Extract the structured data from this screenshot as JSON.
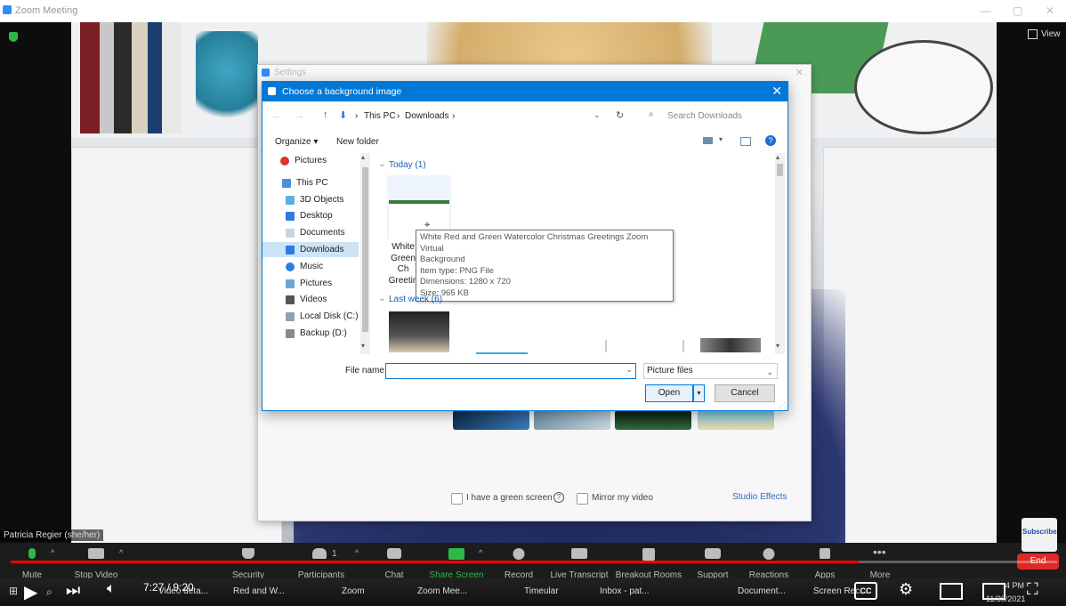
{
  "zoom_window": {
    "title": "Zoom Meeting",
    "view_label": "View",
    "participant_name": "Patricia Regier (she/her)"
  },
  "settings_window": {
    "title": "Settings",
    "green_screen_label": "I have a green screen",
    "mirror_label": "Mirror my video",
    "studio_effects_label": "Studio Effects"
  },
  "file_dialog": {
    "title": "Choose a background image",
    "breadcrumb": [
      "This PC",
      "Downloads"
    ],
    "search_placeholder": "Search Downloads",
    "organize_label": "Organize",
    "new_folder_label": "New folder",
    "nav_items": [
      {
        "label": "Pictures",
        "icon": "pictures-icon"
      },
      {
        "label": "This PC",
        "icon": "computer-icon"
      },
      {
        "label": "3D Objects",
        "icon": "cube-icon"
      },
      {
        "label": "Desktop",
        "icon": "desktop-icon"
      },
      {
        "label": "Documents",
        "icon": "document-icon"
      },
      {
        "label": "Downloads",
        "icon": "download-icon"
      },
      {
        "label": "Music",
        "icon": "music-icon"
      },
      {
        "label": "Pictures",
        "icon": "pictures-icon"
      },
      {
        "label": "Videos",
        "icon": "video-icon"
      },
      {
        "label": "Local Disk (C:)",
        "icon": "disk-icon"
      },
      {
        "label": "Backup (D:)",
        "icon": "disk-icon"
      }
    ],
    "group_today": "Today (1)",
    "group_last_week": "Last week (6)",
    "file_label_lines": [
      "White",
      "Green",
      "Ch",
      "Greetin"
    ],
    "tooltip": {
      "line1": "White Red and Green Watercolor Christmas Greetings Zoom Virtual",
      "line2": "Background",
      "line3": "Item type: PNG File",
      "line4": "Dimensions: 1280 x 720",
      "line5": "Size: 965 KB"
    },
    "file_name_label": "File name:",
    "file_name_value": "",
    "file_type": "Picture files",
    "open_label": "Open",
    "cancel_label": "Cancel"
  },
  "zoom_toolbar": {
    "items": [
      "Mute",
      "Stop Video",
      "Security",
      "Participants",
      "Chat",
      "Share Screen",
      "Record",
      "Live Transcript",
      "Breakout Rooms",
      "Support",
      "Reactions",
      "Apps",
      "More"
    ],
    "participants_count": "1",
    "end_label": "End",
    "share_color": "#2fb84a",
    "end_color": "#e02828"
  },
  "video_player": {
    "time": "7:27 / 9:20",
    "progress": 0.81,
    "taskbar_items": [
      "Video deta...",
      "Red and W...",
      "Zoom",
      "Zoom Mee...",
      "Timeular",
      "Inbox - pat...",
      "Document...",
      "Screen Rec..."
    ],
    "clock_time": "4 PM",
    "clock_date": "11/30/2021",
    "subscribe_label": "Subscribe"
  }
}
